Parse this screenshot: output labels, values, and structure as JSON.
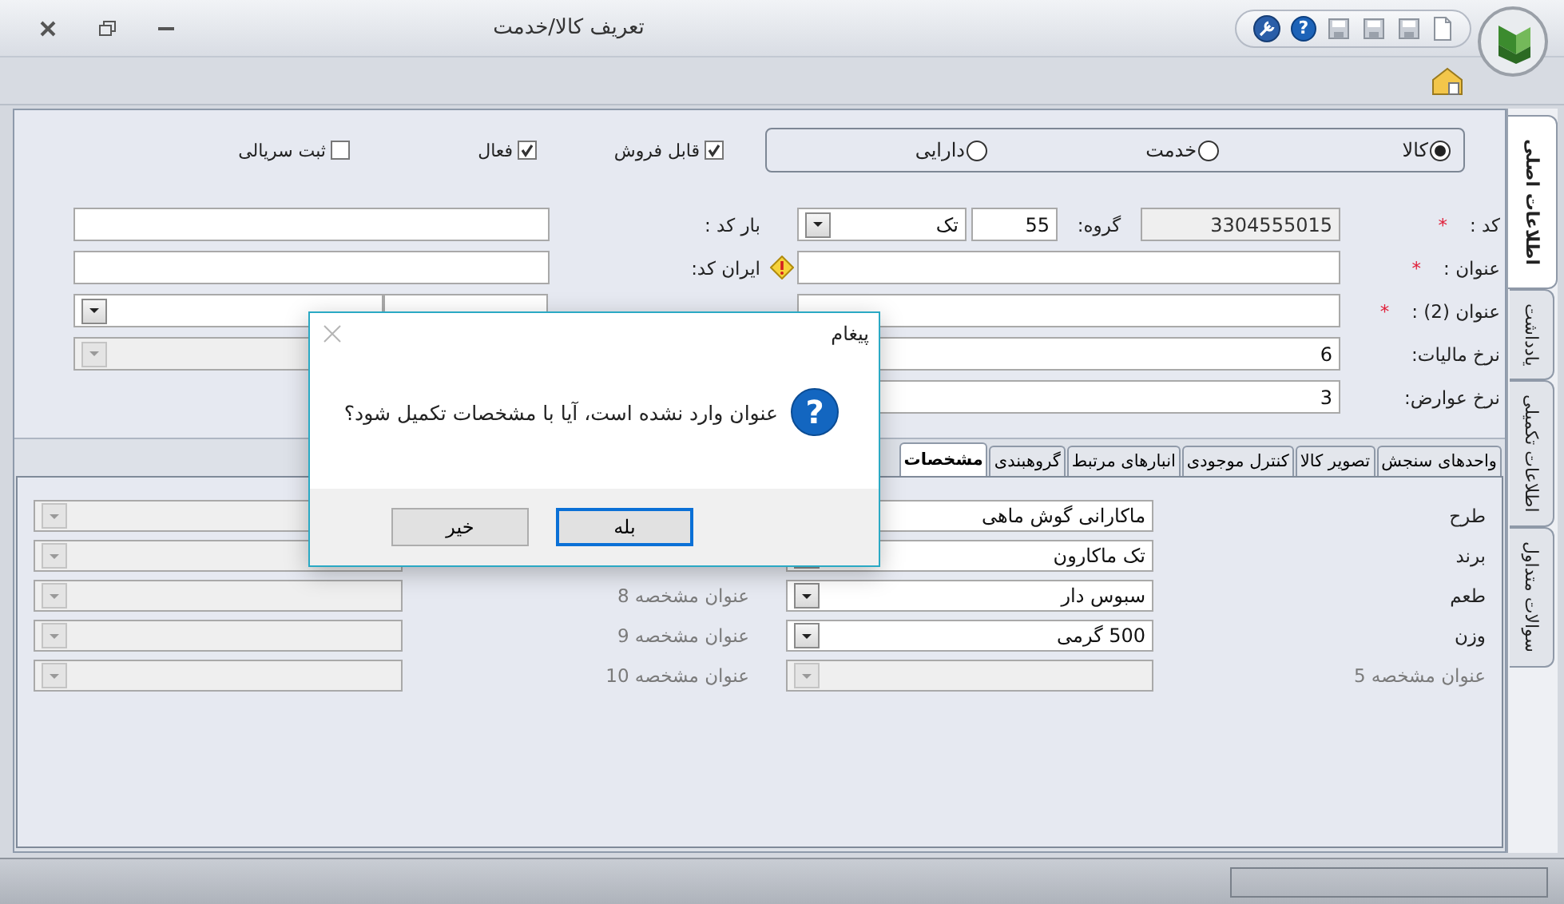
{
  "window": {
    "title": "تعریف کالا/خدمت",
    "help_glyph": "?"
  },
  "item_type": [
    {
      "label": "کالا",
      "selected": true
    },
    {
      "label": "خدمت",
      "selected": false
    },
    {
      "label": "دارایی",
      "selected": false
    }
  ],
  "flags": [
    {
      "label": "قابل فروش",
      "checked": true
    },
    {
      "label": "فعال",
      "checked": true
    },
    {
      "label": "ثبت سریالی",
      "checked": false
    }
  ],
  "fields": [
    {
      "label": "کد :",
      "mark": "*",
      "main": [
        {
          "kind": "text",
          "value": "3304555015",
          "disabled": true
        },
        {
          "kind": "caption",
          "text": "گروه:"
        },
        {
          "kind": "text",
          "value": "55",
          "disabled": false
        },
        {
          "kind": "combo",
          "value": "تک",
          "disabled": false
        }
      ],
      "side_label": "بار کد :",
      "side": [
        {
          "kind": "text",
          "disabled": false
        }
      ]
    },
    {
      "label": "عنوان :",
      "mark": "*",
      "warning": true,
      "main": [
        {
          "kind": "text",
          "disabled": false
        }
      ],
      "side_label": "ایران کد:",
      "side": [
        {
          "kind": "text",
          "disabled": false
        }
      ]
    },
    {
      "label": "عنوان (2) :",
      "mark": "*",
      "main": [
        {
          "kind": "text",
          "disabled": false
        }
      ],
      "side": [
        {
          "kind": "combo",
          "disabled": false
        },
        {
          "kind": "text",
          "disabled": false
        }
      ]
    },
    {
      "label": "نرخ مالیات:",
      "main": [
        {
          "kind": "text",
          "value": "6",
          "disabled": false
        }
      ],
      "side": [
        {
          "kind": "combo",
          "disabled": true
        }
      ]
    },
    {
      "label": "نرخ عوارض:",
      "main": [
        {
          "kind": "text",
          "value": "3",
          "disabled": false
        }
      ]
    }
  ],
  "tabs": [
    {
      "label": "واحدهای سنجش",
      "selected": false
    },
    {
      "label": "تصویر کالا",
      "selected": false
    },
    {
      "label": "کنترل موجودی",
      "selected": false
    },
    {
      "label": "انبارهای مرتبط",
      "selected": false
    },
    {
      "label": "گروهبندی",
      "selected": false
    },
    {
      "label": "مشخصات",
      "selected": true
    }
  ],
  "specs": {
    "right": [
      {
        "label": "طرح",
        "value": "ماکارانی گوش ماهی",
        "kind": "text",
        "disabled": false
      },
      {
        "label": "برند",
        "value": "تک ماکارون",
        "kind": "combo",
        "disabled": false
      },
      {
        "label": "طعم",
        "value": "سبوس دار",
        "kind": "combo",
        "disabled": false
      },
      {
        "label": "وزن",
        "value": "500 گرمی",
        "kind": "combo",
        "disabled": false
      },
      {
        "label": "عنوان مشخصه 5",
        "kind": "combo",
        "disabled": true
      }
    ],
    "left": [
      {
        "kind": "combo",
        "disabled": true
      },
      {
        "kind": "combo",
        "disabled": true
      },
      {
        "label": "عنوان مشخصه 8",
        "kind": "combo",
        "disabled": true
      },
      {
        "label": "عنوان مشخصه 9",
        "kind": "combo",
        "disabled": true
      },
      {
        "label": "عنوان مشخصه 10",
        "kind": "combo",
        "disabled": true
      }
    ]
  },
  "side_tabs": [
    {
      "label": "اطلاعات اصلی",
      "selected": true
    },
    {
      "label": "یادداشت",
      "selected": false
    },
    {
      "label": "اطلاعات تکمیلی",
      "selected": false
    },
    {
      "label": "سوالات متداول",
      "selected": false
    }
  ],
  "dialog": {
    "title": "پیغام",
    "icon_glyph": "?",
    "message": "عنوان وارد نشده است، آیا با مشخصات تکمیل شود؟",
    "buttons": [
      {
        "label": "بله",
        "focused": true
      },
      {
        "label": "خیر",
        "focused": false
      }
    ]
  }
}
